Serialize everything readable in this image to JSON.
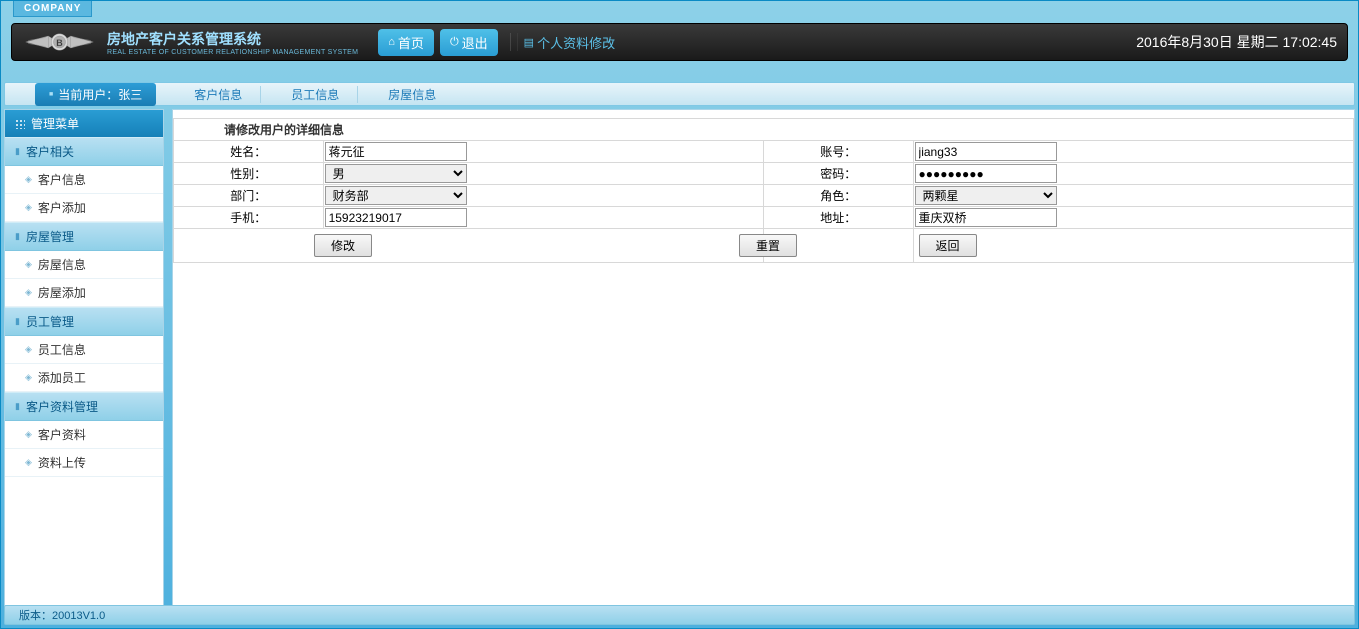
{
  "company_tag": "COMPANY",
  "header": {
    "title": "房地产客户关系管理系统",
    "subtitle": "REAL ESTATE OF CUSTOMER RELATIONSHIP MANAGEMENT SYSTEM",
    "home_label": "首页",
    "logout_label": "退出",
    "profile_label": "个人资料修改",
    "datetime": "2016年8月30日  星期二  17:02:45"
  },
  "menubar": {
    "current_user_prefix": "当前用户：",
    "current_user": "张三",
    "items": [
      "客户信息",
      "员工信息",
      "房屋信息"
    ]
  },
  "sidebar": {
    "title": "管理菜单",
    "groups": [
      {
        "label": "客户相关",
        "items": [
          "客户信息",
          "客户添加"
        ]
      },
      {
        "label": "房屋管理",
        "items": [
          "房屋信息",
          "房屋添加"
        ]
      },
      {
        "label": "员工管理",
        "items": [
          "员工信息",
          "添加员工"
        ]
      },
      {
        "label": "客户资料管理",
        "items": [
          "客户资料",
          "资料上传"
        ]
      }
    ]
  },
  "form": {
    "title": "请修改用户的详细信息",
    "labels": {
      "name": "姓名：",
      "account": "账号：",
      "gender": "性别：",
      "password": "密码：",
      "dept": "部门：",
      "role": "角色：",
      "phone": "手机：",
      "address": "地址："
    },
    "values": {
      "name": "蒋元征",
      "account": "jiang33",
      "gender": "男",
      "password": "●●●●●●●●●",
      "dept": "财务部",
      "role": "两颗星",
      "phone": "15923219017",
      "address": "重庆双桥"
    },
    "buttons": {
      "modify": "修改",
      "reset": "重置",
      "back": "返回"
    }
  },
  "footer": {
    "version": "版本：20013V1.0"
  }
}
